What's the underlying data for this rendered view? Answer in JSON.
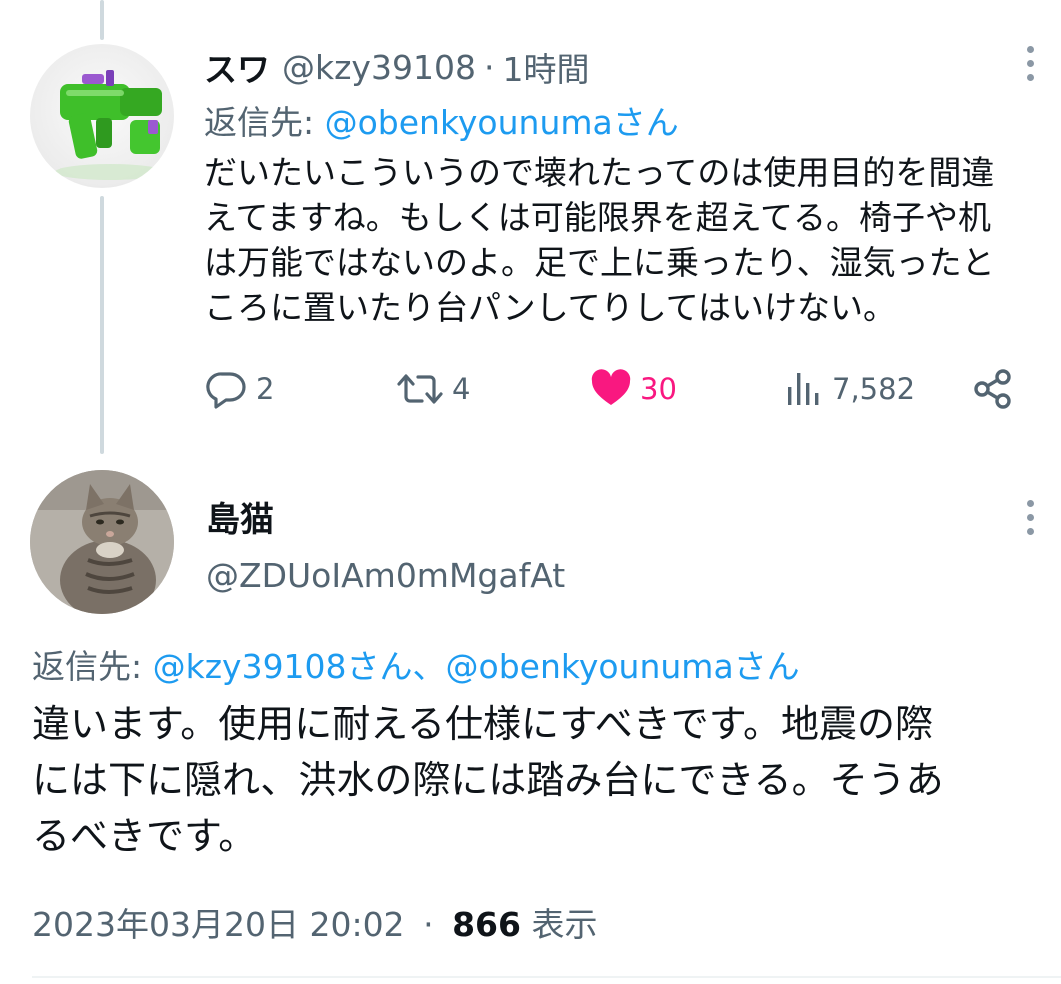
{
  "tweet1": {
    "name": "スワ",
    "handle": "@kzy39108",
    "separator": "·",
    "time": "1時間",
    "reply_to_label": "返信先: ",
    "reply_to_mention": "@obenkyounumaさん",
    "body_lines": [
      "だいたいこういうので壊れたってのは使用目的を間違",
      "えてますね。もしくは可能限界を超えてる。椅子や机",
      "は万能ではないのよ。足で上に乗ったり、湿気ったと",
      "ころに置いたり台パンしてりしてはいけない。"
    ],
    "actions": {
      "replies": "2",
      "retweets": "4",
      "likes": "30",
      "views": "7,582"
    }
  },
  "tweet2": {
    "name": "島猫",
    "handle": "@ZDUoIAm0mMgafAt",
    "reply_to_label": "返信先: ",
    "reply_to_mentions": "@kzy39108さん、@obenkyounumaさん",
    "body_lines": [
      "違います。使用に耐える仕様にすべきです。地震の際",
      "には下に隠れ、洪水の際には踏み台にできる。そうあ",
      "るべきです。"
    ],
    "timestamp": "2023年03月20日 20:02",
    "separator": "·",
    "view_count": "866",
    "view_label": "表示"
  },
  "icons": [
    "more-icon",
    "reply-icon",
    "retweet-icon",
    "like-icon",
    "views-icon",
    "share-icon"
  ],
  "colors": {
    "link": "#1d9bf0",
    "like": "#f91880",
    "secondary_text": "#536471",
    "primary_text": "#0f1419"
  }
}
